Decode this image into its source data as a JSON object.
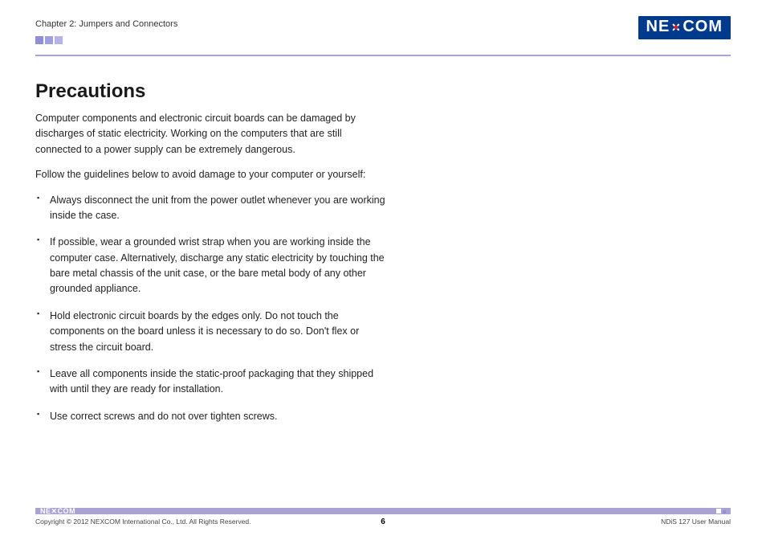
{
  "header": {
    "chapter": "Chapter 2: Jumpers and Connectors",
    "logo_text_left": "NE",
    "logo_text_right": "COM"
  },
  "title": "Precautions",
  "intro": "Computer components and electronic circuit boards can be damaged by discharges of static electricity. Working on the computers that are still connected to a power supply can be extremely dangerous.",
  "follow": "Follow the guidelines below to avoid damage to your computer or yourself:",
  "bullets": [
    "Always disconnect the unit from the power outlet whenever you are working inside the case.",
    "If possible, wear a grounded wrist strap when you are working inside the computer case. Alternatively, discharge any static electricity by touching the bare metal chassis of the unit case, or the bare metal body of any other grounded appliance.",
    "Hold electronic circuit boards by the edges only. Do not touch the components on the board unless it is necessary to do so. Don't flex or stress the circuit board.",
    "Leave all components inside the static-proof packaging that they shipped with until they are ready for installation.",
    "Use correct screws and do not over tighten screws."
  ],
  "footer": {
    "copyright": "Copyright © 2012 NEXCOM International Co., Ltd. All Rights Reserved.",
    "page": "6",
    "manual": "NDiS 127 User Manual",
    "footer_logo_left": "NE",
    "footer_logo_right": "COM"
  }
}
